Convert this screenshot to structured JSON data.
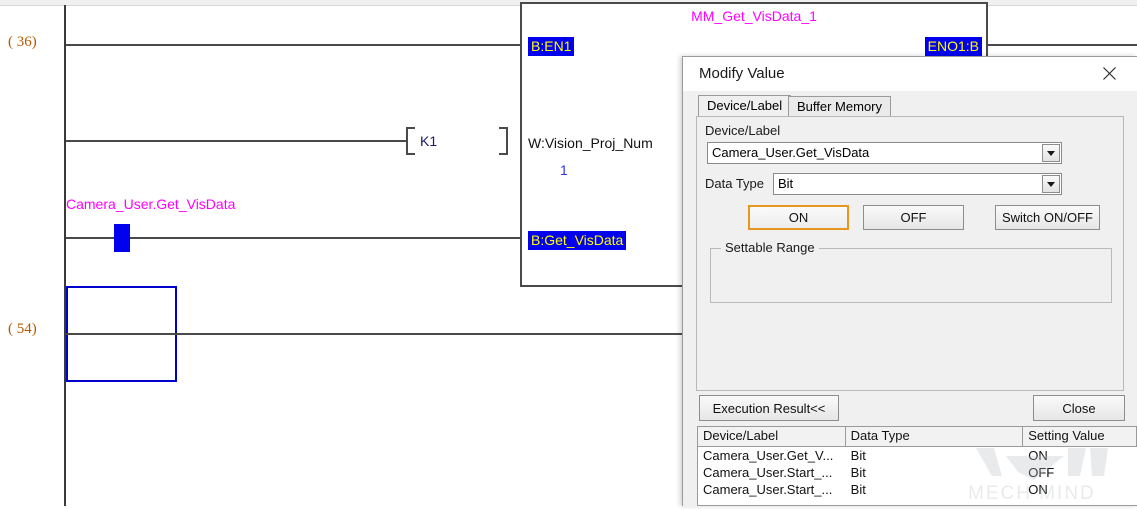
{
  "ladder": {
    "rungs": [
      {
        "step": "(  36)"
      },
      {
        "step": "(  54)"
      }
    ],
    "contact": {
      "label": "Camera_User.Get_VisData",
      "state": "on"
    },
    "constant": {
      "text": "K1"
    },
    "function_block": {
      "title": "MM_Get_VisData_1",
      "pins": [
        {
          "name": "B:EN1",
          "style": "highlight"
        },
        {
          "name": "ENO1:B",
          "style": "highlight"
        },
        {
          "name": "W:Vision_Proj_Num",
          "style": "plain",
          "value": "1"
        },
        {
          "name": "B:Get_VisData",
          "style": "highlight"
        }
      ]
    }
  },
  "dialog": {
    "title": "Modify Value",
    "close_icon": "close-icon",
    "tabs": [
      {
        "label": "Device/Label",
        "active": true
      },
      {
        "label": "Buffer Memory",
        "active": false
      }
    ],
    "device_label": {
      "label": "Device/Label",
      "value": "Camera_User.Get_VisData"
    },
    "data_type": {
      "label": "Data Type",
      "value": "Bit"
    },
    "buttons": {
      "on": "ON",
      "off": "OFF",
      "switch": "Switch ON/OFF",
      "execution_result_toggle": "Execution Result<<",
      "close": "Close"
    },
    "settable_range": {
      "title": "Settable Range",
      "content": ""
    },
    "execution_result": {
      "heading": "Execution Result",
      "columns": [
        "Device/Label",
        "Data Type",
        "Setting Value"
      ],
      "rows": [
        [
          "Camera_User.Get_V...",
          "Bit",
          "ON"
        ],
        [
          "Camera_User.Start_...",
          "Bit",
          "OFF"
        ],
        [
          "Camera_User.Start_...",
          "Bit",
          "ON"
        ]
      ]
    }
  },
  "watermark": {
    "text": "MECH MIND"
  },
  "colors": {
    "contact_blue": "#0000ee",
    "label_magenta": "#ff00ff",
    "pin_yellow": "#ffff00",
    "step_orange": "#b35a00",
    "focus_orange": "#e8971e",
    "cursor_blue": "#0000cc"
  }
}
